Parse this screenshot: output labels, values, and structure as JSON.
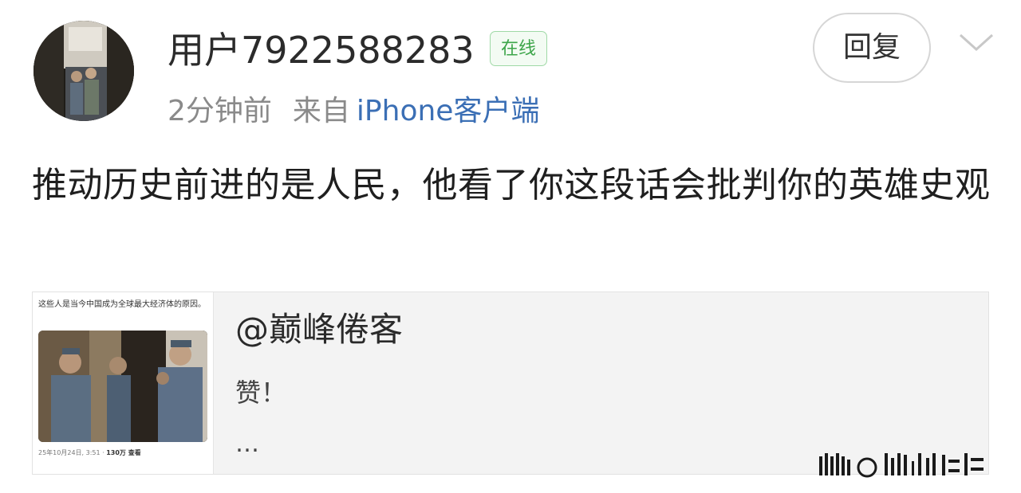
{
  "post": {
    "username": "用户7922588283",
    "online_badge": "在线",
    "reply_label": "回复",
    "time": "2分钟前",
    "from_label": "来自",
    "client": "iPhone客户端",
    "text": "推动历史前进的是人民，他看了你这段话会批判你的英雄史观"
  },
  "quote": {
    "author": "@巅峰倦客",
    "body": "赞！",
    "ellipsis": "…",
    "thumbnail": {
      "caption": "这些人是当今中国成为全球最大经济体的原因。",
      "date": "25年10月24日, 3:51 · ",
      "views": "130万 查看"
    }
  },
  "icons": {
    "avatar": "avatar-photo",
    "chevron": "chevron-down-icon",
    "watermark": "watermark-logo"
  },
  "colors": {
    "online_green": "#3da54a",
    "link_blue": "#3b6fb5",
    "card_bg": "#f3f3f3"
  }
}
